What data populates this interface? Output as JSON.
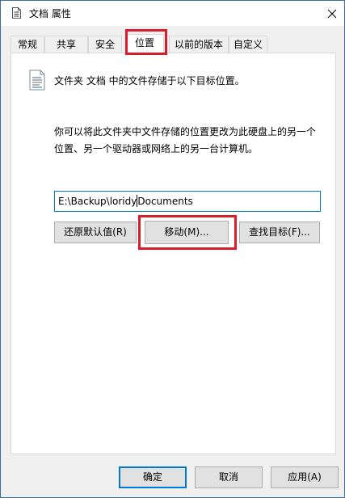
{
  "window": {
    "title": "文档 属性",
    "title_icon": "document-icon",
    "close_icon": "close-icon"
  },
  "tabs": [
    {
      "label": "常规"
    },
    {
      "label": "共享"
    },
    {
      "label": "安全"
    },
    {
      "label": "位置",
      "active": true
    },
    {
      "label": "以前的版本"
    },
    {
      "label": "自定义"
    }
  ],
  "location": {
    "icon": "folder-location-icon",
    "intro": "文件夹 文档 中的文件存储于以下目标位置。",
    "description_lines": [
      "你可以将此文件夹中文件存储的位置更改为此硬盘上的另一个",
      "位置、另一个驱动器或网络上的另一台计算机。"
    ],
    "path_before_caret": "E:\\Backup\\loridy",
    "path_after_caret": "Documents",
    "buttons": {
      "restore": "还原默认值(R)",
      "move": "移动(M)...",
      "find_target": "查找目标(F)..."
    }
  },
  "footer": {
    "ok": "确定",
    "cancel": "取消",
    "apply": "应用(A)"
  },
  "colors": {
    "highlight": "#d81e2a",
    "accent": "#0078d7"
  }
}
